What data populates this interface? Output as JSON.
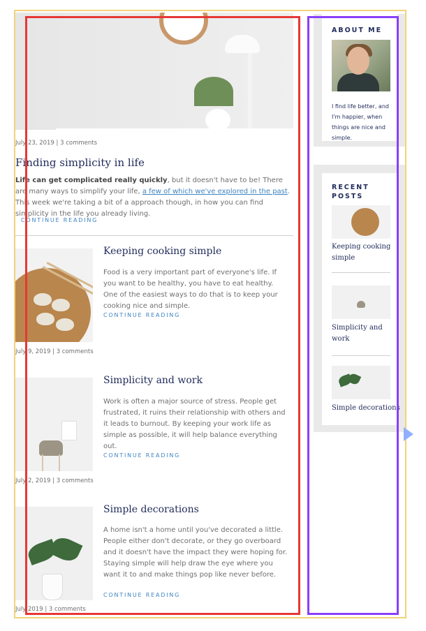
{
  "hero_post": {
    "meta": "July 23, 2019  |  3 comments",
    "title": "Finding simplicity in life",
    "excerpt_bold": "Life can get complicated really quickly",
    "excerpt_part1": ", but it doesn't have to be! There are many ways to simplify your life, ",
    "excerpt_link": "a few of which we've explored in the past",
    "excerpt_part2": ". This week we're taking a bit of a approach though, in how you can find simplicity in the life you already living.",
    "read_more": "CONTINUE READING"
  },
  "posts": [
    {
      "title": "Keeping cooking simple",
      "excerpt": "Food is a very important part of everyone's life. If you want to be healthy, you have to eat healthy. One of the easiest ways to do that is to keep your cooking nice and simple.",
      "read_more": "CONTINUE READING",
      "meta": "July 9, 2019  |  3 comments"
    },
    {
      "title": "Simplicity and work",
      "excerpt": "Work is often a major source of stress. People get frustrated, it ruins their relationship with others and it leads to burnout. By keeping your work life as simple as possible, it will help balance everything out.",
      "read_more": "CONTINUE READING",
      "meta": "July 2, 2019  |  3 comments"
    },
    {
      "title": "Simple decorations",
      "excerpt": "A home isn't a home until you've decorated a little. People either don't decorate, or they go overboard and it doesn't have the impact they were hoping for. Staying simple will help draw the eye where you want it to and make things pop like never before.",
      "read_more": "CONTINUE READING",
      "meta": "July 2019  |  3 comments"
    }
  ],
  "sidebar": {
    "about": {
      "title": "ABOUT ME",
      "text": "I find life better, and I'm happier, when things are nice and simple."
    },
    "recent": {
      "title_line1": "RECENT",
      "title_line2": "POSTS",
      "items": [
        {
          "label": "Keeping cooking simple"
        },
        {
          "label": "Simplicity and work"
        },
        {
          "label": "Simple decorations"
        }
      ]
    }
  },
  "colors": {
    "heading": "#1f2a5a",
    "link": "#3f84c2",
    "frame_yellow": "#f2d27a",
    "frame_red": "#e53935",
    "frame_purple": "#8a3ffc"
  }
}
